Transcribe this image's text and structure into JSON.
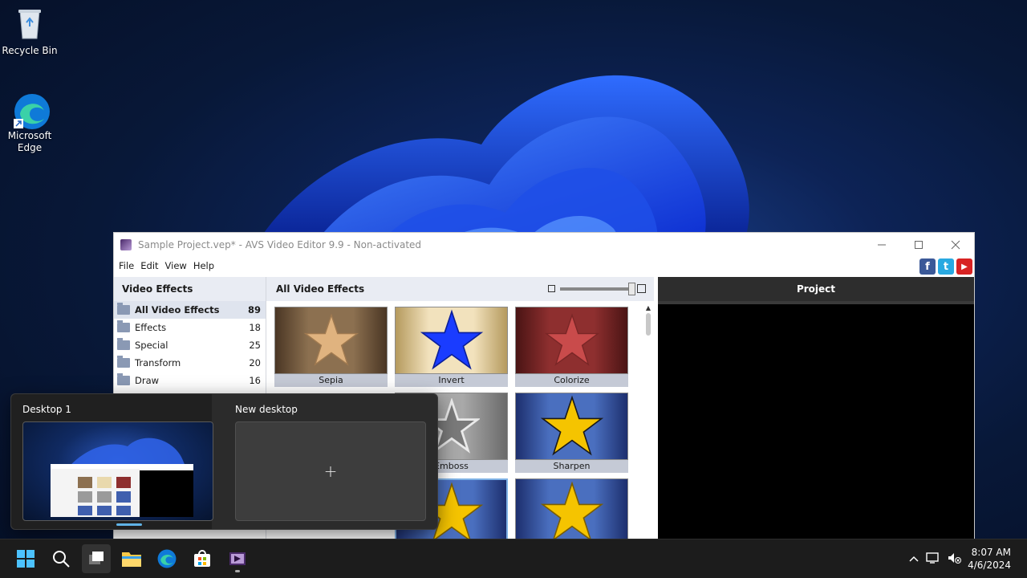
{
  "desktop": {
    "icons": [
      {
        "label": "Recycle Bin"
      },
      {
        "label": "Microsoft Edge"
      }
    ]
  },
  "window": {
    "title": "Sample Project.vep* - AVS Video Editor 9.9 - Non-activated",
    "menu": [
      "File",
      "Edit",
      "View",
      "Help"
    ],
    "social": {
      "facebook": "f",
      "twitter": "t",
      "youtube": "▶"
    }
  },
  "left_pane": {
    "header": "Video Effects",
    "categories": [
      {
        "name": "All Video Effects",
        "count": "89"
      },
      {
        "name": "Effects",
        "count": "18"
      },
      {
        "name": "Special",
        "count": "25"
      },
      {
        "name": "Transform",
        "count": "20"
      },
      {
        "name": "Draw",
        "count": "16"
      }
    ]
  },
  "middle_pane": {
    "header": "All Video Effects",
    "effects": [
      "Sepia",
      "Invert",
      "Colorize",
      "Emboss",
      "Sharpen"
    ]
  },
  "right_pane": {
    "header": "Project"
  },
  "task_view": {
    "desktop1": "Desktop 1",
    "new_desktop": "New desktop",
    "plus": "+"
  },
  "taskbar": {
    "time": "8:07 AM",
    "date": "4/6/2024"
  },
  "colors": {
    "accent": "#0078d4",
    "star_gold": "#f5c400",
    "star_blue": "#1a3cff",
    "star_red": "#c94b4b"
  }
}
